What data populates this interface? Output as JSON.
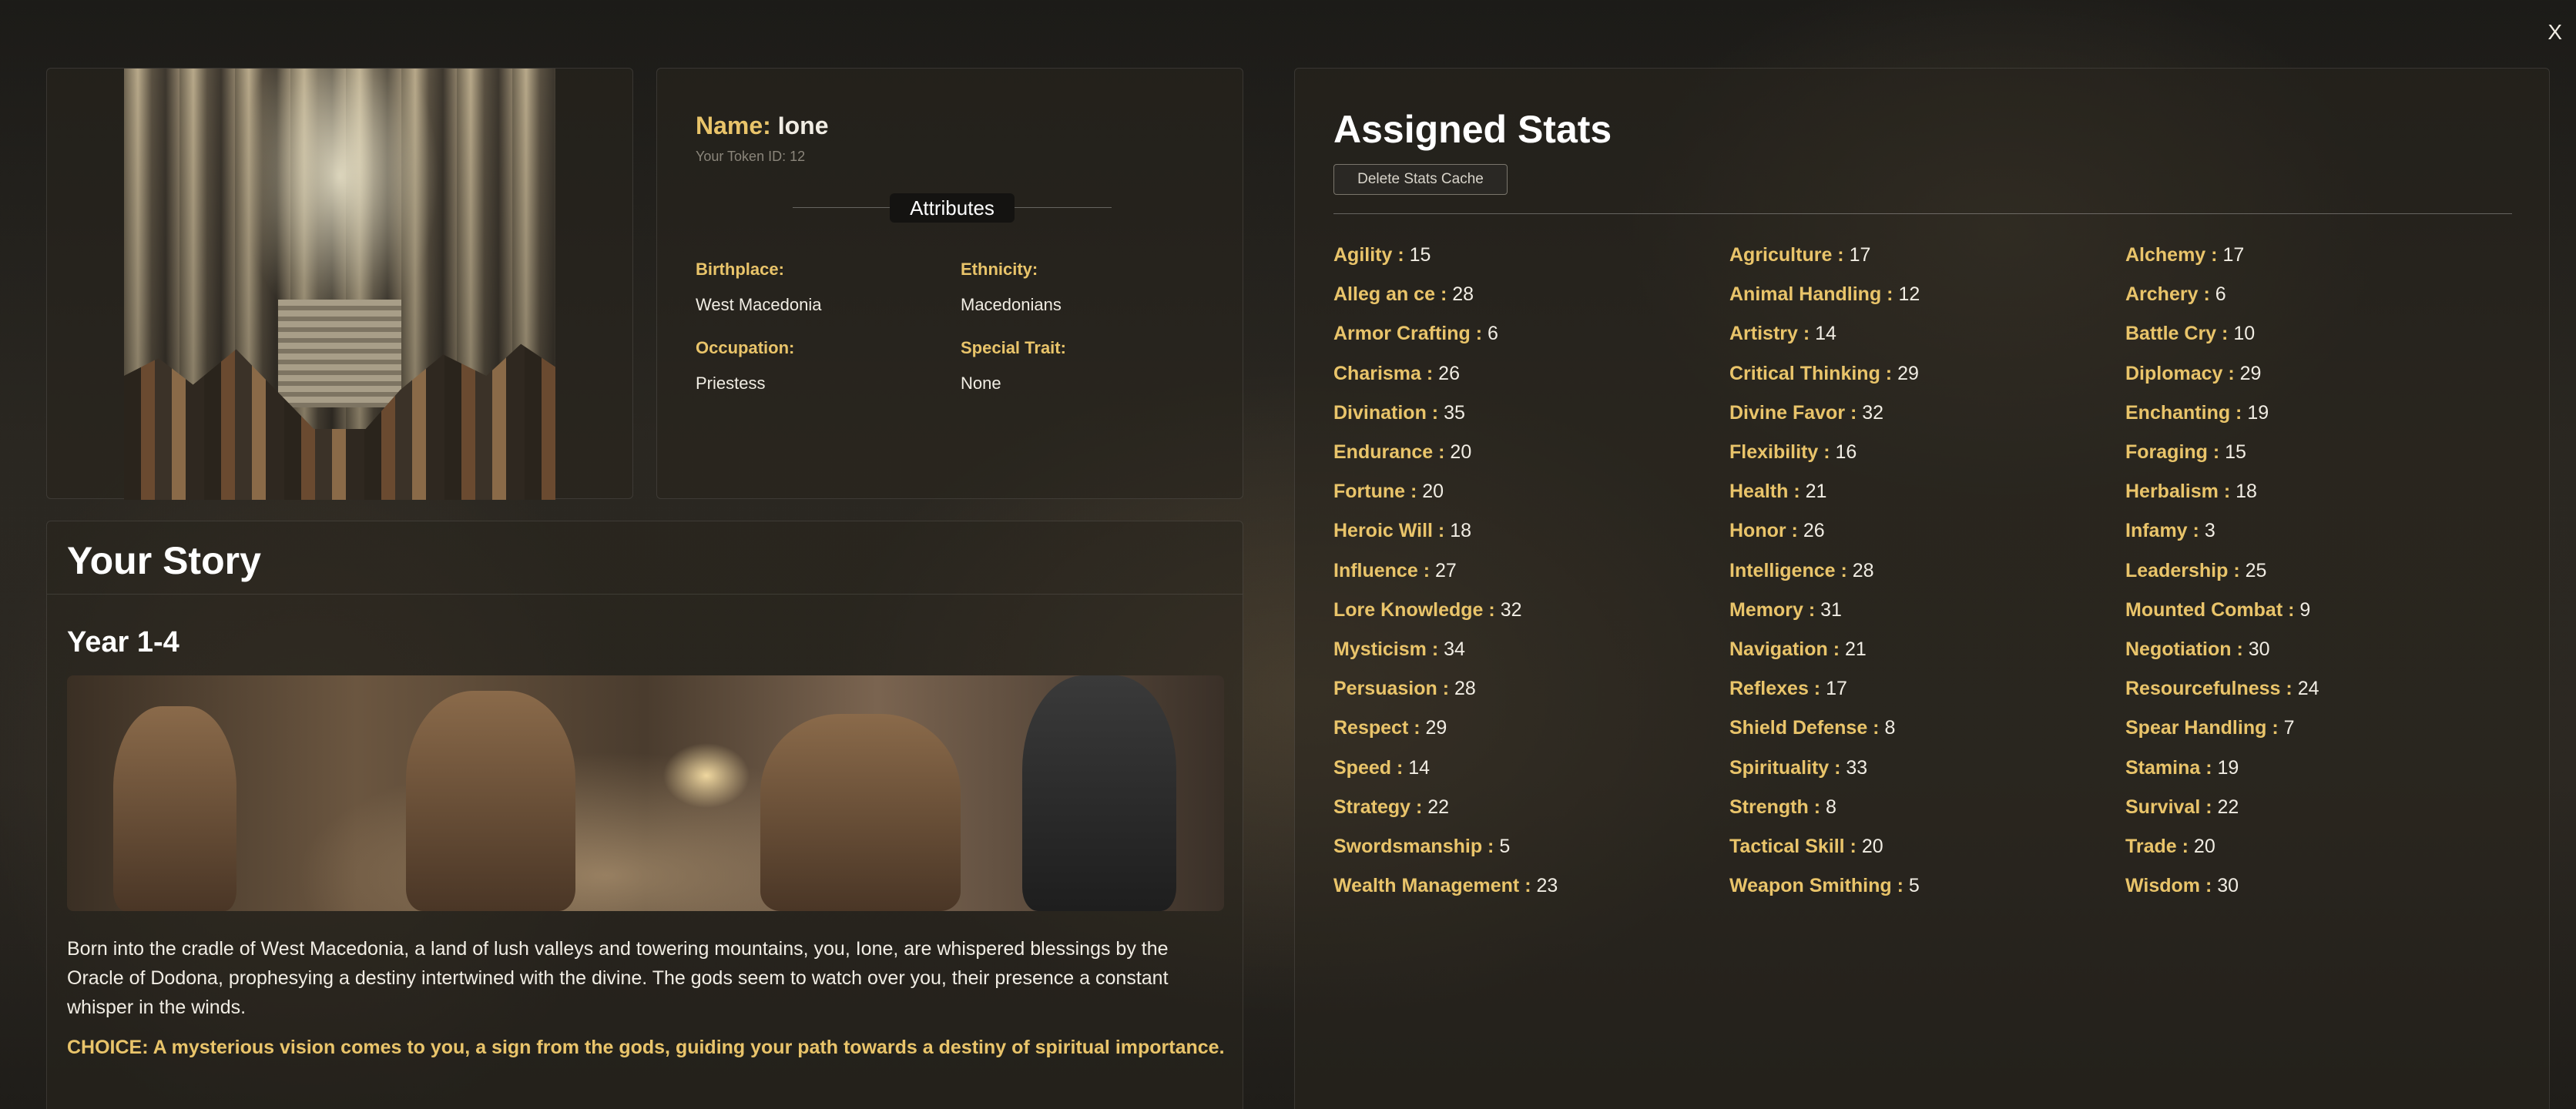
{
  "window": {
    "close_label": "X"
  },
  "profile": {
    "name_label": "Name:",
    "name": "Ione",
    "token_text": "Your Token ID: 12",
    "attributes_heading": "Attributes",
    "attributes": [
      {
        "key": "Birthplace:",
        "value": "West Macedonia"
      },
      {
        "key": "Ethnicity:",
        "value": "Macedonians"
      },
      {
        "key": "Occupation:",
        "value": "Priestess"
      },
      {
        "key": "Special Trait:",
        "value": "None"
      }
    ]
  },
  "stats": {
    "title": "Assigned Stats",
    "delete_cache_label": "Delete Stats Cache",
    "items": [
      {
        "name": "Agility",
        "value": "15"
      },
      {
        "name": "Agriculture",
        "value": "17"
      },
      {
        "name": "Alchemy",
        "value": "17"
      },
      {
        "name": "Alleg an ce",
        "value": "28"
      },
      {
        "name": "Animal Handling",
        "value": "12"
      },
      {
        "name": "Archery",
        "value": "6"
      },
      {
        "name": "Armor Crafting",
        "value": "6"
      },
      {
        "name": "Artistry",
        "value": "14"
      },
      {
        "name": "Battle Cry",
        "value": "10"
      },
      {
        "name": "Charisma",
        "value": "26"
      },
      {
        "name": "Critical Thinking",
        "value": "29"
      },
      {
        "name": "Diplomacy",
        "value": "29"
      },
      {
        "name": "Divination",
        "value": "35"
      },
      {
        "name": "Divine Favor",
        "value": "32"
      },
      {
        "name": "Enchanting",
        "value": "19"
      },
      {
        "name": "Endurance",
        "value": "20"
      },
      {
        "name": "Flexibility",
        "value": "16"
      },
      {
        "name": "Foraging",
        "value": "15"
      },
      {
        "name": "Fortune",
        "value": "20"
      },
      {
        "name": "Health",
        "value": "21"
      },
      {
        "name": "Herbalism",
        "value": "18"
      },
      {
        "name": "Heroic Will",
        "value": "18"
      },
      {
        "name": "Honor",
        "value": "26"
      },
      {
        "name": "Infamy",
        "value": "3"
      },
      {
        "name": "Influence",
        "value": "27"
      },
      {
        "name": "Intelligence",
        "value": "28"
      },
      {
        "name": "Leadership",
        "value": "25"
      },
      {
        "name": "Lore Knowledge",
        "value": "32"
      },
      {
        "name": "Memory",
        "value": "31"
      },
      {
        "name": "Mounted Combat",
        "value": "9"
      },
      {
        "name": "Mysticism",
        "value": "34"
      },
      {
        "name": "Navigation",
        "value": "21"
      },
      {
        "name": "Negotiation",
        "value": "30"
      },
      {
        "name": "Persuasion",
        "value": "28"
      },
      {
        "name": "Reflexes",
        "value": "17"
      },
      {
        "name": "Resourcefulness",
        "value": "24"
      },
      {
        "name": "Respect",
        "value": "29"
      },
      {
        "name": "Shield Defense",
        "value": "8"
      },
      {
        "name": "Spear Handling",
        "value": "7"
      },
      {
        "name": "Speed",
        "value": "14"
      },
      {
        "name": "Spirituality",
        "value": "33"
      },
      {
        "name": "Stamina",
        "value": "19"
      },
      {
        "name": "Strategy",
        "value": "22"
      },
      {
        "name": "Strength",
        "value": "8"
      },
      {
        "name": "Survival",
        "value": "22"
      },
      {
        "name": "Swordsmanship",
        "value": "5"
      },
      {
        "name": "Tactical Skill",
        "value": "20"
      },
      {
        "name": "Trade",
        "value": "20"
      },
      {
        "name": "Wealth Management",
        "value": "23"
      },
      {
        "name": "Weapon Smithing",
        "value": "5"
      },
      {
        "name": "Wisdom",
        "value": "30"
      }
    ]
  },
  "story": {
    "title": "Your Story",
    "year_title": "Year 1-4",
    "text": "Born into the cradle of West Macedonia, a land of lush valleys and towering mountains, you, Ione, are whispered blessings by the Oracle of Dodona, prophesying a destiny intertwined with the divine. The gods seem to watch over you, their presence a constant whisper in the winds.",
    "choice": "CHOICE: A mysterious vision comes to you, a sign from the gods, guiding your path towards a destiny of spiritual importance."
  }
}
